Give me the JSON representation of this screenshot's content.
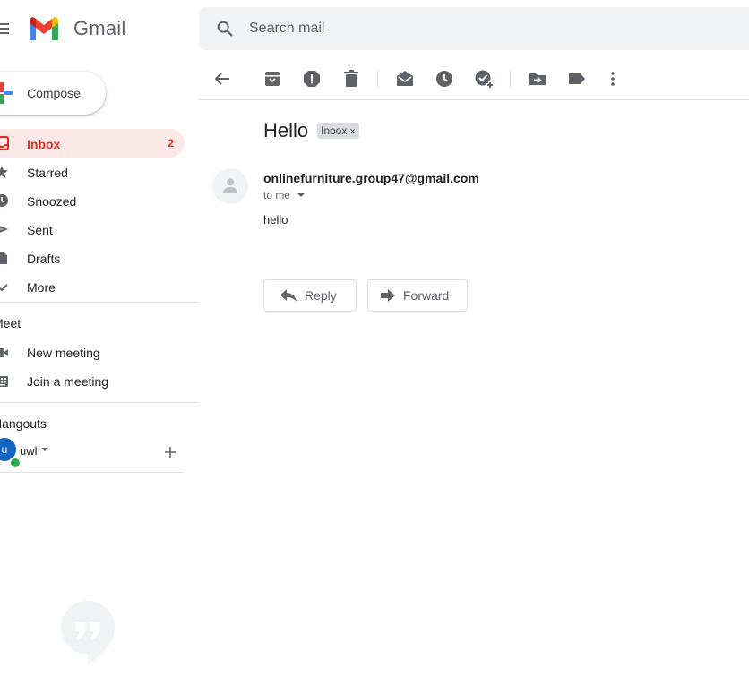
{
  "header": {
    "app_name": "Gmail",
    "search_placeholder": "Search mail"
  },
  "compose": {
    "label": "Compose"
  },
  "sidebar": {
    "items": [
      {
        "label": "Inbox",
        "count": "2",
        "icon": "inbox-icon",
        "active": true
      },
      {
        "label": "Starred",
        "icon": "star-icon"
      },
      {
        "label": "Snoozed",
        "icon": "clock-icon"
      },
      {
        "label": "Sent",
        "icon": "send-icon"
      },
      {
        "label": "Drafts",
        "icon": "draft-icon"
      },
      {
        "label": "More",
        "icon": "chevron-down-icon"
      }
    ]
  },
  "meet": {
    "title": "Meet",
    "items": [
      {
        "label": "New meeting",
        "icon": "video-icon"
      },
      {
        "label": "Join a meeting",
        "icon": "keyboard-icon"
      }
    ]
  },
  "hangouts": {
    "title": "Hangouts",
    "avatar_letter": "u",
    "user": "uwl"
  },
  "toolbar": {
    "icons": [
      "back-arrow-icon",
      "archive-icon",
      "report-spam-icon",
      "delete-icon",
      "mark-unread-icon",
      "snooze-icon",
      "add-to-tasks-icon",
      "move-to-icon",
      "label-icon",
      "more-vert-icon"
    ]
  },
  "message": {
    "subject": "Hello",
    "label": "Inbox",
    "label_close": "×",
    "sender": "onlinefurniture.group47@gmail.com",
    "recipient": "to me",
    "body": "hello",
    "reply_label": "Reply",
    "forward_label": "Forward"
  },
  "colors": {
    "accent_red": "#d93025",
    "active_bg": "#fce8e6",
    "search_bg": "#f1f3f4",
    "presence_green": "#34a853"
  }
}
